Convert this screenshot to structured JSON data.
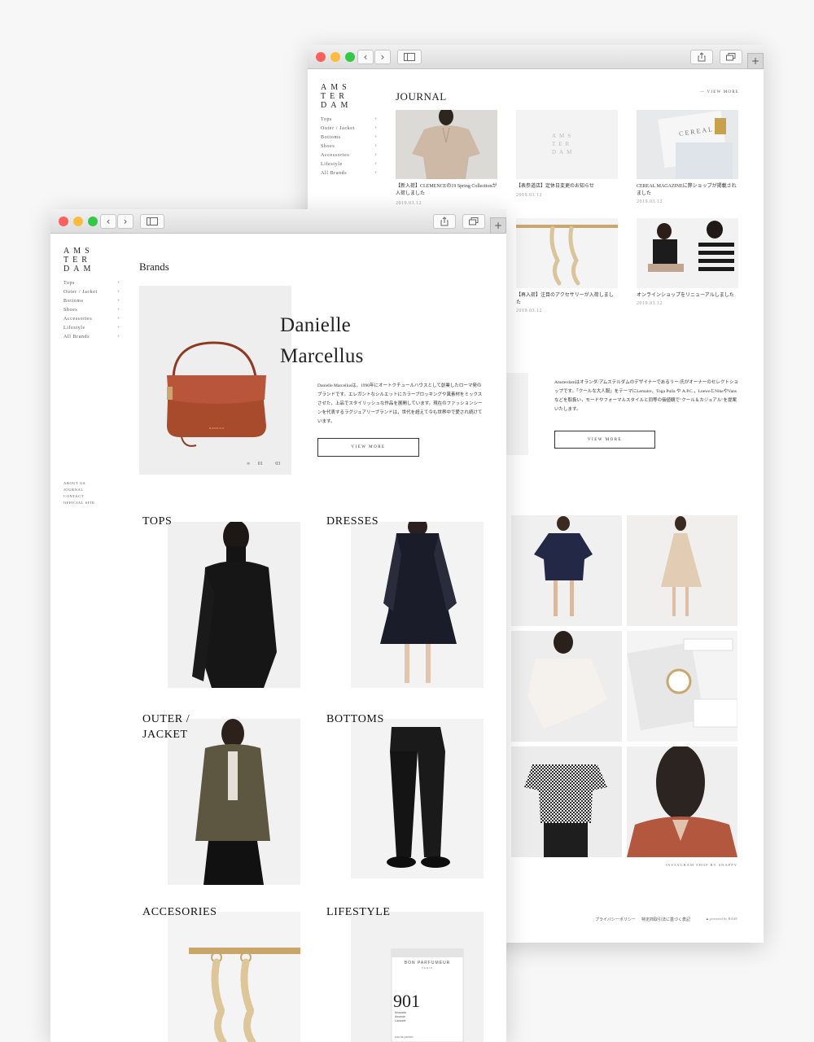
{
  "back_window": {
    "logo": "AMS\nTER\nDAM",
    "nav": [
      "Tops",
      "Outer / Jacket",
      "Bottoms",
      "Shoes",
      "Accessories",
      "Lifestyle",
      "All Brands"
    ],
    "journal_title": "JOURNAL",
    "view_more_link": "VIEW MORE",
    "journal": [
      {
        "caption": "【新入荷】CLEMENCEの19 Spring Collectionが入荷しました",
        "date": "2019.03.12"
      },
      {
        "caption": "【表参道店】定休日変更のお知らせ",
        "date": "2019.03.12",
        "placeholder_logo": "AMS\nTER\nDAM"
      },
      {
        "caption": "CEREAL MAGAZINEに弊ショップが掲載されました",
        "date": "2019.03.12",
        "magazine_text": "CEREAL"
      },
      {
        "caption": "【再入荷】注目のアクセサリーが入荷しました",
        "date": "2019.03.12"
      },
      {
        "caption": "オンラインショップをリニューアルしました",
        "date": "2019.03.12"
      }
    ],
    "about_text": "Amsterdamはオランダ/アムステルダムのデザイナーであるリー/氏がオーナーのセレクトショップです。「クールな大人服」をテーマにLemaire，Toga Pulla や A.P.C.，LoeweとNikeやVansなどを取扱い，モードやフォーマルスタイルと同等の価値観で\"クール＆カジュアル\"を提案いたします。",
    "about_button": "VIEW MORE",
    "instagram_label": "INSTAGRAM SHOP BY SNAPPY",
    "footer_links": [
      "プライバシーポリシー",
      "特定商取引法に基づく表記"
    ],
    "powered": "powered by BASE"
  },
  "front_window": {
    "logo": "AMS\nTER\nDAM",
    "nav": [
      "Tops",
      "Outer / Jacket",
      "Bottoms",
      "Shoes",
      "Accessories",
      "Lifestyle",
      "All Brands"
    ],
    "footer_nav": [
      "ABOUT US",
      "JOURNAL",
      "CONTACT",
      "OFFICIAL SITE"
    ],
    "brands_title": "Brands",
    "brand_name": "Danielle\nMarcellus",
    "brand_text": "Danielle Marcellusは，1990年にオートクチュールハウスとして創業したローマ発のブランドです。エレガントなシルエットにカラーブロッキングや異素材をミックスさせた，上品でスタイリッシュな作品を展開しています。現在のファッションシーンを代表するラグジュアリーブランドは，世代を超えて今も世界中で愛され続けています。",
    "brand_button": "VIEW MORE",
    "slide_current": "01",
    "slide_total": "03",
    "bag_label": "DANIELLE",
    "categories": [
      "TOPS",
      "DRESSES",
      "OUTER /\nJACKET",
      "BOTTOMS",
      "ACCESORIES",
      "LIFESTYLE"
    ],
    "perfume_brand": "BON PARFUMEUR",
    "perfume_sub": "PARIS",
    "perfume_number": "901",
    "perfume_notes": "Muscade\nAmande\nLavande",
    "perfume_edp": "eau de parfum"
  },
  "colors": {
    "accent_bag": "#a84a2c",
    "accent_orange": "#b4573f",
    "text": "#222222"
  }
}
